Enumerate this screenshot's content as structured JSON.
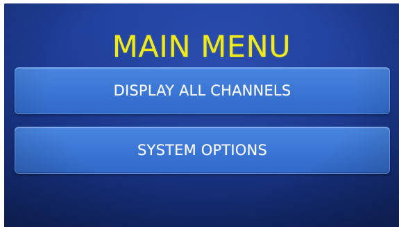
{
  "screen": {
    "title": "MAIN MENU",
    "title_color": "#f0ea18",
    "background_color": "#1c3a92"
  },
  "menu": {
    "items": [
      {
        "label": "DISPLAY ALL CHANNELS"
      },
      {
        "label": "SYSTEM OPTIONS"
      }
    ],
    "button_color": "#3d78d6"
  }
}
